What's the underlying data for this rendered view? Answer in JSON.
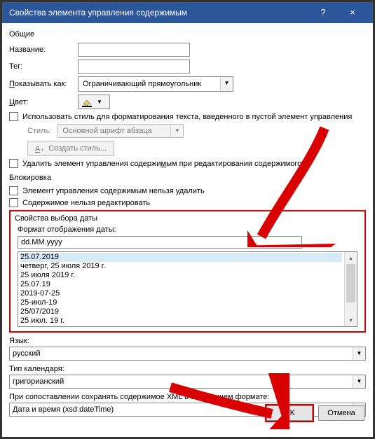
{
  "title": "Свойства элемента управления содержимым",
  "sections": {
    "general": "Общие",
    "lock": "Блокировка",
    "date_props": "Свойства выбора даты"
  },
  "labels": {
    "name": "Название:",
    "tag": "Тег:",
    "show_as_pre": "П",
    "show_as_post": "оказывать как:",
    "color_pre": "Ц",
    "color_post": "вет:",
    "use_style": "Использовать стиль для форматирования текста, введенного в пустой элемент управления",
    "style": "Стиль:",
    "create_style": "Создать стиль...",
    "delete_cc_pre": "Удалить элемент управления содержи",
    "delete_cc_u": "м",
    "delete_cc_post": "ым при редактировании содержимого",
    "cant_delete": "Элемент управления содержимым нельзя удалить",
    "cant_edit": "Содержимое нельзя редактировать",
    "format_label": "Формат отображения даты:",
    "language": "Язык:",
    "cal_type": "Тип календаря:",
    "xml_map": "При сопоставлении сохранять содержимое XML в следующем формате:"
  },
  "values": {
    "name": "",
    "tag": "",
    "show_as": "Ограничивающий прямоугольник",
    "style": "Основной шрифт абзаца",
    "format": "dd.MM.yyyy",
    "language": "русский",
    "cal_type": "григорианский",
    "xml_mode": "Дата и время (xsd:dateTime)"
  },
  "format_examples": [
    "25.07.2019",
    "четверг, 25 июля 2019 г.",
    "25 июля 2019 г.",
    "25.07.19",
    "2019-07-25",
    "25-июл-19",
    "25/07/2019",
    "25 июл. 19 г."
  ],
  "buttons": {
    "ok": "OK",
    "cancel": "Отмена"
  }
}
